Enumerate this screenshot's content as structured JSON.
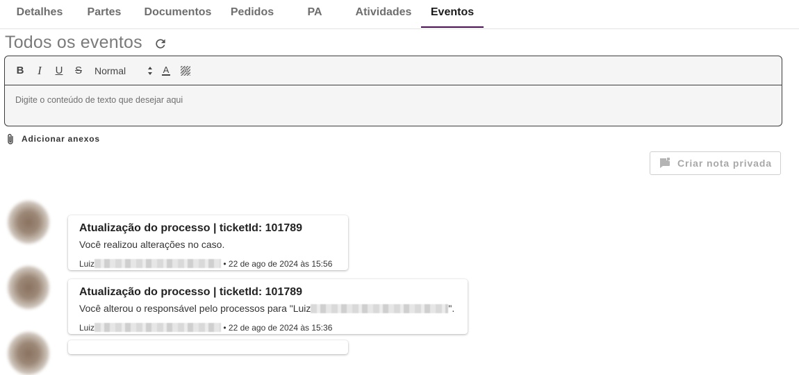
{
  "tabs": [
    {
      "label": "Detalhes",
      "active": false
    },
    {
      "label": "Partes",
      "active": false
    },
    {
      "label": "Documentos",
      "active": false
    },
    {
      "label": "Pedidos",
      "active": false
    },
    {
      "label": "PA",
      "active": false
    },
    {
      "label": "Atividades",
      "active": false
    },
    {
      "label": "Eventos",
      "active": true
    }
  ],
  "page": {
    "title": "Todos os eventos",
    "refresh_icon": "refresh-icon"
  },
  "editor": {
    "toolbar": {
      "bold": "B",
      "italic": "I",
      "underline": "U",
      "strike": "S",
      "size_select": "Normal",
      "text_color_icon": "A",
      "background_color_icon": "A"
    },
    "placeholder": "Digite o conteúdo de texto que desejar aqui"
  },
  "attachments": {
    "label": "Adicionar anexos",
    "icon": "paperclip-icon"
  },
  "private_note_button": {
    "label": "Criar nota privada",
    "icon": "note-icon"
  },
  "events": [
    {
      "title": "Atualização do processo | ticketId: 101789",
      "text": "Você realizou alterações no caso.",
      "author": "Luiz",
      "date": "• 22 de ago de 2024 às 15:56"
    },
    {
      "title": "Atualização do processo | ticketId: 101789",
      "text_before": "Você alterou o responsável pelo processos para \"Luiz",
      "text_after": "\".",
      "author": "Luiz",
      "date": "• 22 de ago de 2024 às 15:36"
    }
  ],
  "colors": {
    "active_tab_underline": "#4a0f55",
    "editor_background": "#f5f5f5",
    "disabled_button_text": "#a8a8a8"
  }
}
